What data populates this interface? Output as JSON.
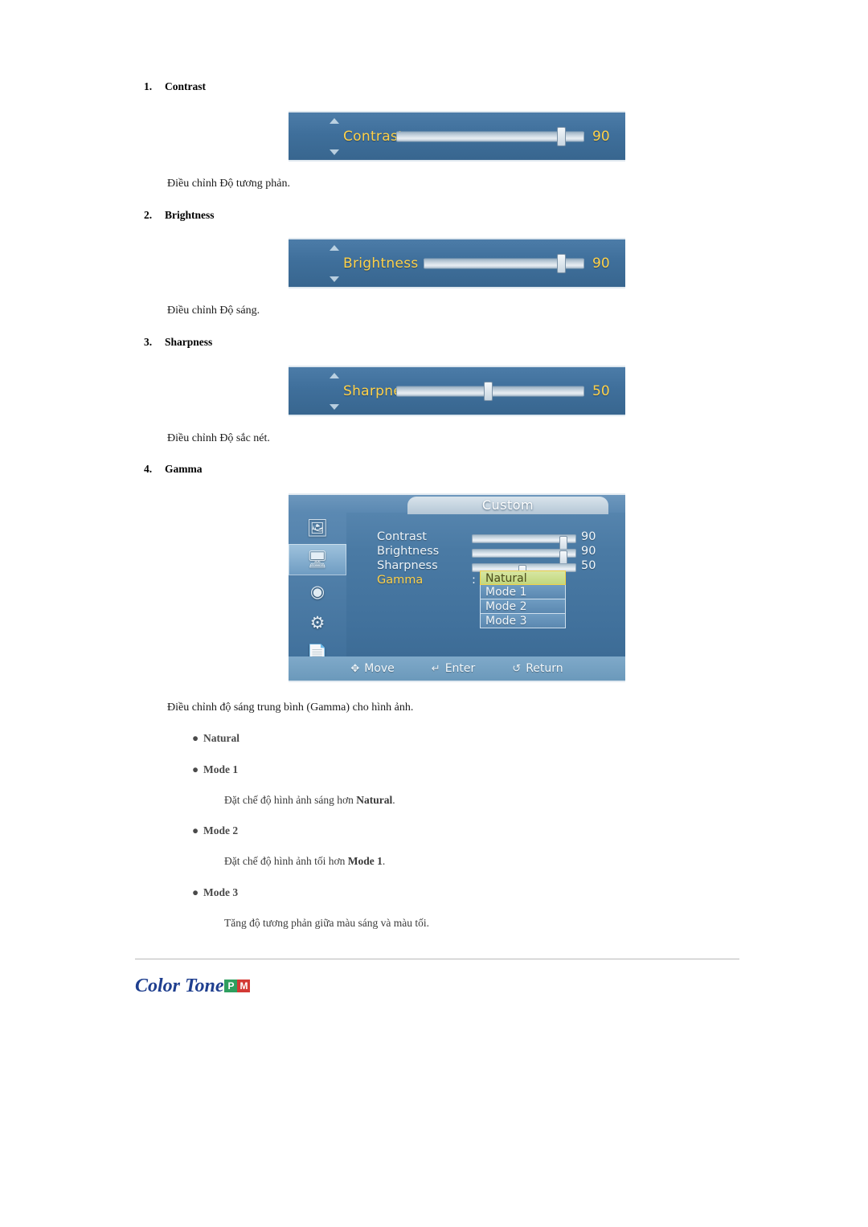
{
  "items": [
    {
      "num": "1.",
      "label": "Contrast"
    },
    {
      "num": "2.",
      "label": "Brightness"
    },
    {
      "num": "3.",
      "label": "Sharpness"
    },
    {
      "num": "4.",
      "label": "Gamma"
    }
  ],
  "captions": [
    "Điều chỉnh Độ tương phản.",
    "Điều chỉnh Độ sáng.",
    "Điều chỉnh Độ sắc nét.",
    "Điều chỉnh độ sáng trung bình (Gamma) cho hình ảnh."
  ],
  "osd_bars": [
    {
      "label": "Contrast",
      "value": "90"
    },
    {
      "label": "Brightness",
      "value": "90"
    },
    {
      "label": "Sharpness",
      "value": "50"
    }
  ],
  "osd_menu": {
    "title": "Custom",
    "icons": [
      "picture-icon",
      "monitor-icon",
      "sound-icon",
      "gear-icon",
      "input-icon"
    ],
    "rows": [
      {
        "label": "Contrast",
        "value": "90"
      },
      {
        "label": "Brightness",
        "value": "90"
      },
      {
        "label": "Sharpness",
        "value": "50"
      },
      {
        "label": "Gamma",
        "value": ":"
      }
    ],
    "dropdown": [
      "Natural",
      "Mode 1",
      "Mode 2",
      "Mode 3"
    ],
    "selected": "Natural",
    "footer": [
      {
        "glyph": "✥",
        "label": "Move"
      },
      {
        "glyph": "⏎",
        "label": "Enter"
      },
      {
        "glyph": "↺",
        "label": "Return"
      }
    ]
  },
  "gamma_options": [
    {
      "name": "Natural",
      "desc": ""
    },
    {
      "name": "Mode 1",
      "desc_pre": "Đặt chế độ hình ảnh sáng hơn ",
      "desc_bold": "Natural",
      "desc_post": "."
    },
    {
      "name": "Mode 2",
      "desc_pre": "Đặt chế độ hình ảnh tối hơn ",
      "desc_bold": "Mode 1",
      "desc_post": "."
    },
    {
      "name": "Mode 3",
      "desc_pre": "Tăng độ tương phản giữa màu sáng và màu tối.",
      "desc_bold": "",
      "desc_post": ""
    }
  ],
  "section": {
    "heading": "Color Tone",
    "badge_p": "P",
    "badge_m": "M"
  }
}
